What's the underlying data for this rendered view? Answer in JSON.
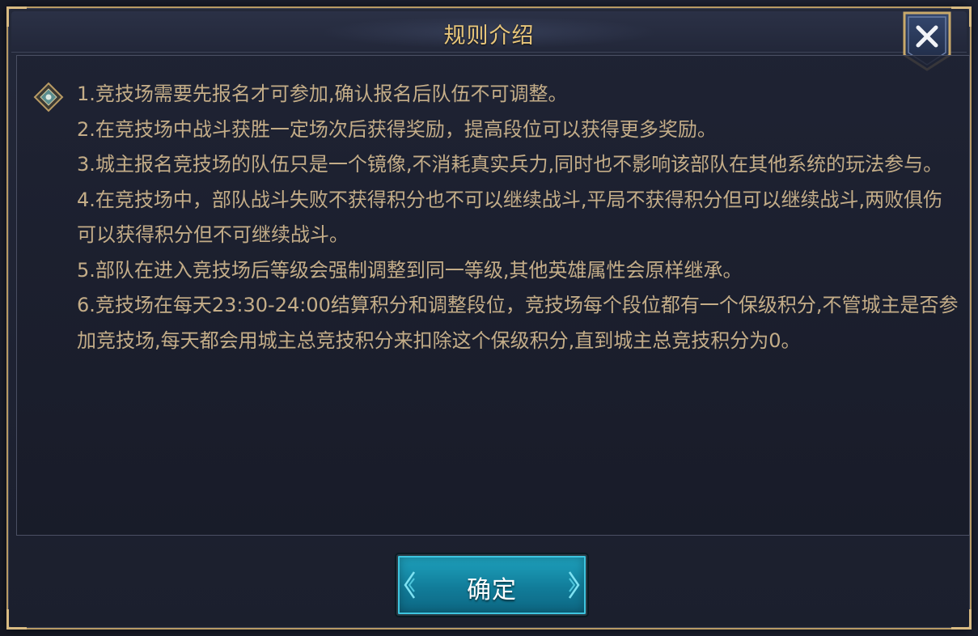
{
  "dialog": {
    "title": "规则介绍",
    "accent_gold": "#e8c67a",
    "text_color": "#c4ad88"
  },
  "icons": {
    "close": "close-x-icon",
    "bullet": "diamond-bullet-icon"
  },
  "rules": [
    "1.竞技场需要先报名才可参加,确认报名后队伍不可调整。",
    "2.在竞技场中战斗获胜一定场次后获得奖励，提高段位可以获得更多奖励。",
    "3.城主报名竞技场的队伍只是一个镜像,不消耗真实兵力,同时也不影响该部队在其他系统的玩法参与。",
    "4.在竞技场中，部队战斗失败不获得积分也不可以继续战斗,平局不获得积分但可以继续战斗,两败俱伤可以获得积分但不可继续战斗。",
    "5.部队在进入竞技场后等级会强制调整到同一等级,其他英雄属性会原样继承。",
    "6.竞技场在每天23:30-24:00结算积分和调整段位，竞技场每个段位都有一个保级积分,不管城主是否参加竞技场,每天都会用城主总竞技积分来扣除这个保级积分,直到城主总竞技积分为0。"
  ],
  "buttons": {
    "confirm_label": "确定",
    "confirm_color": "#1a98b6"
  }
}
